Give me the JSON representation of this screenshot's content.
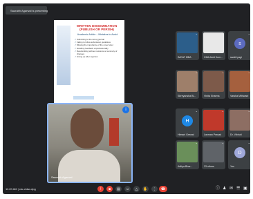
{
  "presenting": {
    "label": "Saurabh Agarwal is presenting"
  },
  "slide": {
    "title": "WRITTEN DISSEMINATION (PUBLISH OR PERISH)",
    "subtitle": "Academic Article – Mistakes to Avoid",
    "bullets": [
      "Submitting to the wrong journal",
      "Failing to follow submission guidelines",
      "Missing the importance of the cover letter",
      "Handling feedback unprofessionally",
      "Resubmitting without revisions or summary of changes",
      "Giving up after rejection"
    ]
  },
  "camera": {
    "name": "Saurabh Agarwal",
    "badge": "i"
  },
  "tiles": [
    {
      "name": "IMCAT MBA",
      "kind": "photo",
      "color": "#2c5e8a"
    },
    {
      "name": "CMA Amit Kum...",
      "kind": "photo",
      "color": "#e8e8e8"
    },
    {
      "name": "swati tyagi",
      "kind": "letter",
      "letter": "s",
      "color": "#5c6bc0"
    },
    {
      "name": "Shreyansha Bi...",
      "kind": "photo",
      "color": "#9e7f6a"
    },
    {
      "name": "Vinita Sharma",
      "kind": "photo",
      "color": "#7d5a4a"
    },
    {
      "name": "Varsha Mithwani",
      "kind": "photo",
      "color": "#a5603e"
    },
    {
      "name": "Himani Grewal",
      "kind": "letter",
      "letter": "H",
      "color": "#1e88e5"
    },
    {
      "name": "Laxman Prasad",
      "kind": "photo",
      "color": "#c0392b"
    },
    {
      "name": "Dr. Vibhuti",
      "kind": "photo",
      "color": "#8d6e63"
    },
    {
      "name": "Aditya Bhar...",
      "kind": "photo",
      "color": "#6a8f5a"
    },
    {
      "name": "33 others",
      "kind": "photo",
      "color": "#5f6368"
    },
    {
      "name": "You",
      "kind": "letter",
      "letter": "D",
      "color": "#9fa8da"
    }
  ],
  "bottom": {
    "time": "11:20 AM",
    "separator": "|",
    "meeting_code": "ctu-chkw-dpg"
  },
  "controls": [
    {
      "icon": "mic-off-icon",
      "glyph": "̸",
      "red": true
    },
    {
      "icon": "camera-off-icon",
      "glyph": "■",
      "red": true
    },
    {
      "icon": "captions-icon",
      "glyph": "▤",
      "red": false
    },
    {
      "icon": "emoji-icon",
      "glyph": "☺",
      "red": false
    },
    {
      "icon": "present-icon",
      "glyph": "△",
      "red": false
    },
    {
      "icon": "raise-hand-icon",
      "glyph": "✋",
      "red": false
    },
    {
      "icon": "more-options-icon",
      "glyph": "⋮",
      "red": false
    },
    {
      "icon": "end-call-icon",
      "glyph": "☎",
      "red": true
    }
  ],
  "right_icons": [
    {
      "icon": "info-icon",
      "glyph": "ⓘ"
    },
    {
      "icon": "people-icon",
      "glyph": "♟"
    },
    {
      "icon": "chat-icon",
      "glyph": "✉"
    },
    {
      "icon": "activities-icon",
      "glyph": "☰"
    },
    {
      "icon": "lock-icon",
      "glyph": "▣"
    }
  ]
}
